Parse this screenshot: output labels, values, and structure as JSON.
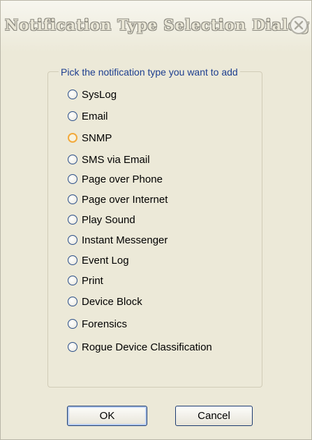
{
  "window": {
    "title": "Notification Type Selection Dialog"
  },
  "group": {
    "legend": "Pick the notification type you want to add"
  },
  "options": [
    {
      "label": "SysLog",
      "selected": false
    },
    {
      "label": "Email",
      "selected": false
    },
    {
      "label": "SNMP",
      "selected": false,
      "hovered": true
    },
    {
      "label": "SMS via Email",
      "selected": false
    },
    {
      "label": "Page over Phone",
      "selected": false
    },
    {
      "label": "Page over Internet",
      "selected": false
    },
    {
      "label": "Play Sound",
      "selected": false
    },
    {
      "label": "Instant Messenger",
      "selected": false
    },
    {
      "label": "Event Log",
      "selected": false
    },
    {
      "label": "Print",
      "selected": false
    },
    {
      "label": "Device Block",
      "selected": false
    },
    {
      "label": "Forensics",
      "selected": false
    },
    {
      "label": "Rogue Device Classification",
      "selected": false
    }
  ],
  "buttons": {
    "ok_label": "OK",
    "cancel_label": "Cancel"
  },
  "icons": {
    "close": "close-icon"
  },
  "colors": {
    "dialog_background": "#ece9d8",
    "legend_text": "#1d3e8f",
    "hover_radio": "#f2a93b",
    "button_border": "#1c3b70"
  }
}
